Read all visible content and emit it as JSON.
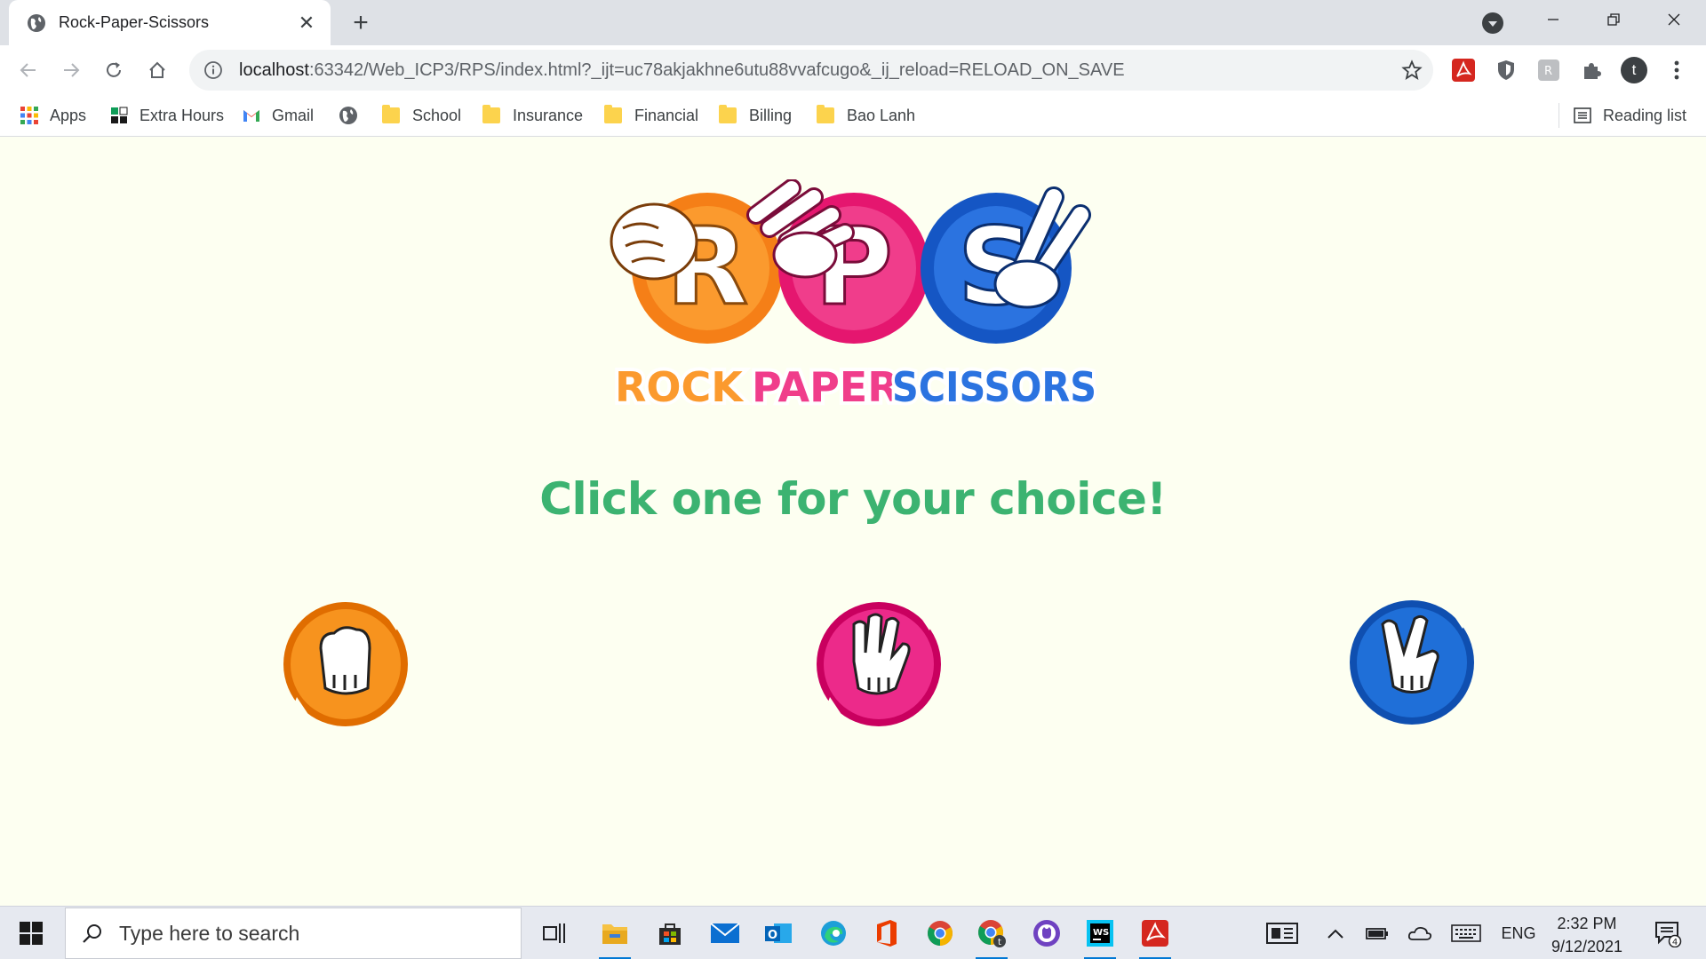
{
  "browser": {
    "tab_title": "Rock-Paper-Scissors",
    "tab_close": "✕",
    "new_tab": "+",
    "url_host": "localhost",
    "url_rest": ":63342/Web_ICP3/RPS/index.html?_ijt=uc78akjakhne6utu88vvafcugo&_ij_reload=RELOAD_ON_SAVE",
    "profile_initial": "t"
  },
  "bookmarks": {
    "items": [
      {
        "label": "Apps",
        "icon": "apps-grid-icon"
      },
      {
        "label": "Extra Hours",
        "icon": "extra-hours-icon"
      },
      {
        "label": "Gmail",
        "icon": "gmail-icon"
      },
      {
        "label": "",
        "icon": "globe-icon"
      },
      {
        "label": "School",
        "icon": "folder-icon"
      },
      {
        "label": "Insurance",
        "icon": "folder-icon"
      },
      {
        "label": "Financial",
        "icon": "folder-icon"
      },
      {
        "label": "Billing",
        "icon": "folder-icon"
      },
      {
        "label": "Bao Lanh",
        "icon": "folder-icon"
      }
    ],
    "reading_list": "Reading list"
  },
  "page": {
    "logo": {
      "r": "R",
      "p": "P",
      "s": "S",
      "rock": "ROCK",
      "paper": "PAPER",
      "scissors": "SCISSORS"
    },
    "headline": "Click one for your choice!",
    "choices": [
      {
        "name": "rock",
        "color": "#f7931e"
      },
      {
        "name": "paper",
        "color": "#ec2a8a"
      },
      {
        "name": "scissors",
        "color": "#1f6fd8"
      }
    ]
  },
  "taskbar": {
    "search_placeholder": "Type here to search",
    "language": "ENG",
    "time": "2:32 PM",
    "date": "9/12/2021",
    "notification_count": "4"
  }
}
